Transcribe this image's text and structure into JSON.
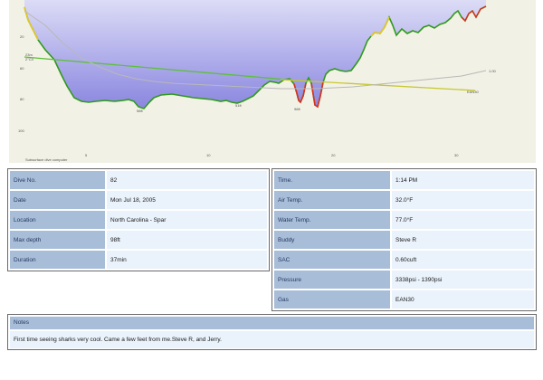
{
  "profile": {
    "y_ticks": [
      "20",
      "60",
      "80",
      "100"
    ],
    "x_ticks": [
      "5",
      "10",
      "20",
      "30"
    ],
    "point_labels": [
      "23m",
      "2°C/l",
      "EAN30",
      "58ft",
      "51ft",
      "96ft",
      "1.00"
    ],
    "footer": "Subsurface dive computer",
    "colors": {
      "background": "#f2f1e5",
      "depth_fill_top": "#dcdcf6",
      "depth_fill_bottom": "#8a86e0",
      "depth_line_good": "#2e9a1a",
      "depth_line_fast": "#e8c820",
      "depth_line_warn": "#d83020",
      "gas_line": "#5cc03a",
      "temp_line": "#c8c830",
      "ambient_line": "#b8b8b8"
    }
  },
  "dive": {
    "left": [
      {
        "label": "Dive No.",
        "value": "82"
      },
      {
        "label": "Date",
        "value": "Mon Jul 18, 2005"
      },
      {
        "label": "Location",
        "value": "North Carolina - Spar"
      },
      {
        "label": "Max depth",
        "value": "98ft"
      },
      {
        "label": "Duration",
        "value": "37min"
      }
    ],
    "right": [
      {
        "label": "Time.",
        "value": "1:14 PM"
      },
      {
        "label": "Air Temp.",
        "value": "32.0°F"
      },
      {
        "label": "Water Temp.",
        "value": "77.0°F"
      },
      {
        "label": "Buddy",
        "value": "Steve R"
      },
      {
        "label": "SAC",
        "value": "0.60cuft"
      },
      {
        "label": "Pressure",
        "value": "3338psi - 1390psi"
      },
      {
        "label": "Gas",
        "value": "EAN30"
      }
    ]
  },
  "notes": {
    "header": "Notes",
    "text": "First time seeing sharks very cool. Came a few feet from me.Steve R, and Jerry."
  }
}
